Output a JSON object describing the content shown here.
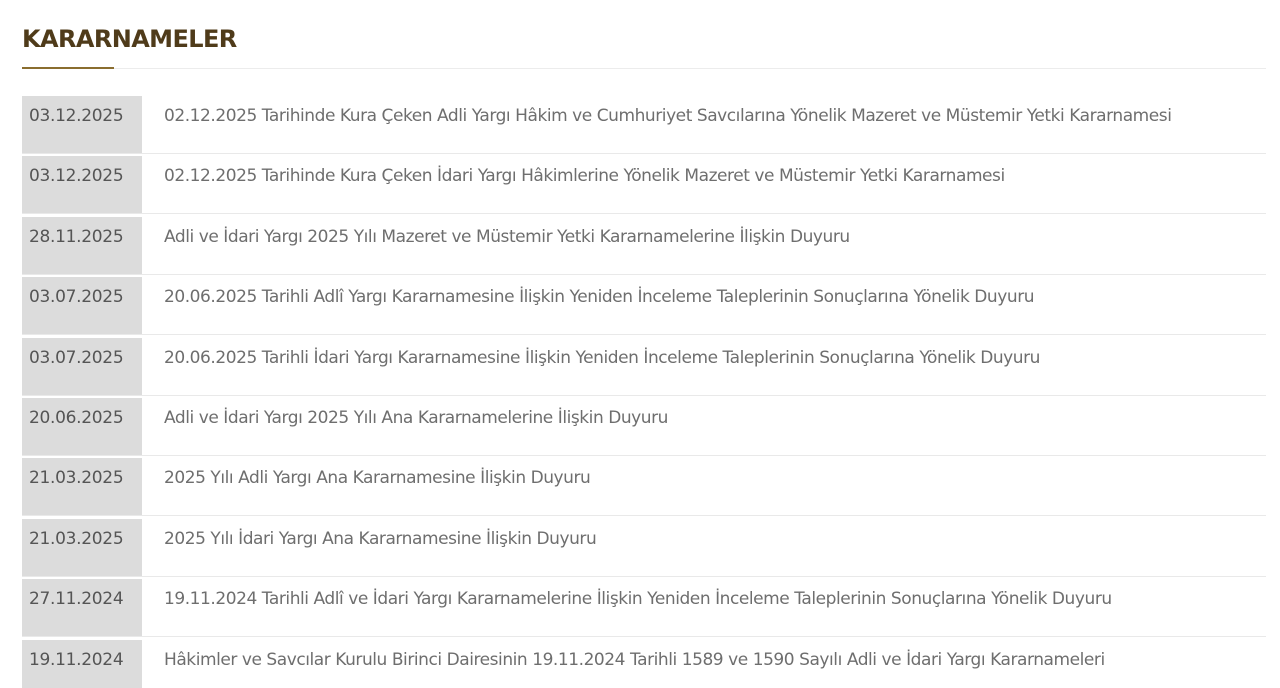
{
  "page": {
    "title": "KARARNAMELER"
  },
  "items": [
    {
      "date": "03.12.2025",
      "title": "02.12.2025 Tarihinde Kura Çeken Adli Yargı Hâkim ve Cumhuriyet Savcılarına Yönelik Mazeret ve Müstemir Yetki Kararnamesi"
    },
    {
      "date": "03.12.2025",
      "title": "02.12.2025 Tarihinde Kura Çeken İdari Yargı Hâkimlerine Yönelik Mazeret ve Müstemir Yetki Kararnamesi"
    },
    {
      "date": "28.11.2025",
      "title": "Adli ve İdari Yargı 2025 Yılı Mazeret ve Müstemir Yetki Kararnamelerine İlişkin Duyuru"
    },
    {
      "date": "03.07.2025",
      "title": "20.06.2025 Tarihli Adlî Yargı Kararnamesine İlişkin Yeniden İnceleme Taleplerinin Sonuçlarına Yönelik Duyuru"
    },
    {
      "date": "03.07.2025",
      "title": "20.06.2025 Tarihli İdari Yargı Kararnamesine İlişkin Yeniden İnceleme Taleplerinin Sonuçlarına Yönelik Duyuru"
    },
    {
      "date": "20.06.2025",
      "title": "Adli ve İdari Yargı 2025 Yılı Ana Kararnamelerine İlişkin Duyuru"
    },
    {
      "date": "21.03.2025",
      "title": "2025 Yılı Adli Yargı Ana Kararnamesine İlişkin Duyuru"
    },
    {
      "date": "21.03.2025",
      "title": "2025 Yılı İdari Yargı Ana Kararnamesine İlişkin Duyuru"
    },
    {
      "date": "27.11.2024",
      "title": "19.11.2024 Tarihli Adlî ve İdari Yargı Kararnamelerine İlişkin Yeniden İnceleme Taleplerinin Sonuçlarına Yönelik Duyuru"
    },
    {
      "date": "19.11.2024",
      "title": "Hâkimler ve Savcılar Kurulu Birinci Dairesinin 19.11.2024 Tarihli 1589 ve 1590 Sayılı Adli ve İdari Yargı Kararnameleri"
    }
  ],
  "colors": {
    "title": "#4f3b1a",
    "title_underline": "#8a6d2f",
    "date_background": "#dcdcdc",
    "date_text": "#555555",
    "link_text": "#6e6e6e"
  }
}
